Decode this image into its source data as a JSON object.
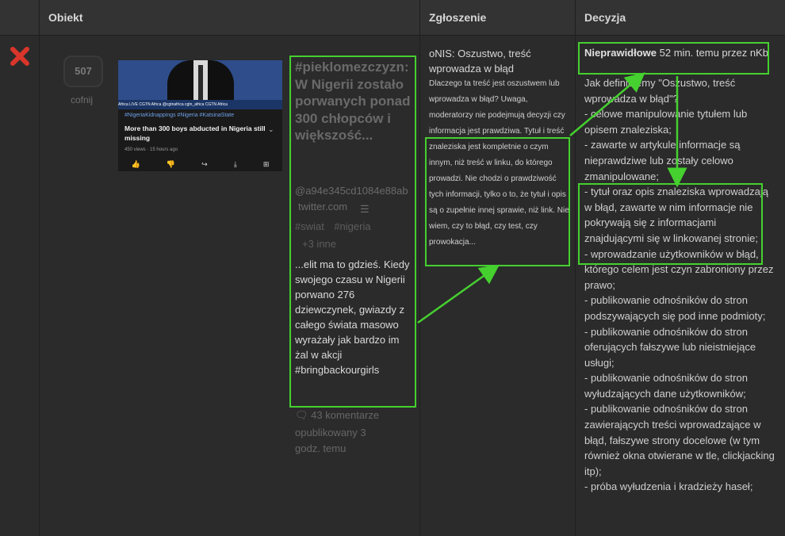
{
  "header": {
    "col_object": "Obiekt",
    "col_report": "Zgłoszenie",
    "col_decision": "Decyzja"
  },
  "vote": {
    "count": "507",
    "undo": "cofnij"
  },
  "thumbnail": {
    "lower_third": "Africa LIVE    CGTN Africa    @cgtnafrica    cgtn_africa    CGTN Africa",
    "tags": "#NigeriaKidnappings #Nigeria #KatsinaState",
    "title": "More than 300 boys abducted in Nigeria still missing",
    "meta": "450 views · 15 hours ago"
  },
  "entry": {
    "title": "#pieklomezczyzn: W Nigerii zostało porwanych ponad 300 chłopców i większość...",
    "hash": "@a94e345cd1084e88ab",
    "domain": "twitter.com",
    "tags": [
      "#swiat",
      "#nigeria"
    ],
    "more_tags": "+3 inne",
    "description": "...elit ma to gdzieś. Kiedy swojego czasu w Nigerii porwano 276 dziewczynek, gwiazdy z całego świata masowo wyrażały jak bardzo im żal w akcji #bringbackourgirls",
    "comments": "43 komentarze",
    "published": "opublikowany 3 godz. temu"
  },
  "report": {
    "reason": "oNIS: Oszustwo, treść wprowadza w błąd",
    "body": "Dlaczego ta treść jest oszustwem lub wprowadza w błąd? Uwaga, moderatorzy nie podejmują decyzji czy informacja jest prawdziwa. Tytuł i treść znaleziska jest kompletnie o czym innym, niż treść w linku, do którego prowadzi. Nie chodzi o prawdziwość tych informacji, tylko o to, że tytuł i opis są o zupełnie innej sprawie, niż link. Nie wiem, czy to błąd, czy test, czy prowokacja..."
  },
  "decision": {
    "verdict": "Nieprawidłowe",
    "time_by": "52 min. temu przez nKb",
    "body": "Jak definiujemy \"Oszustwo, treść wprowadza w błąd\"?\n- celowe manipulowanie tytułem lub opisem znaleziska;\n- zawarte w artykule informacje są nieprawdziwe lub zostały celowo zmanipulowane;\n- tytuł oraz opis znaleziska wprowadzają w błąd, zawarte w nim informacje nie pokrywają się z informacjami znajdującymi się w linkowanej stronie;\n- wprowadzanie użytkowników w błąd, którego celem jest czyn zabroniony przez prawo;\n- publikowanie odnośników do stron podszywających się pod inne podmioty;\n- publikowanie odnośników do stron oferujących fałszywe lub nieistniejące usługi;\n- publikowanie odnośników do stron wyłudzających dane użytkowników;\n- publikowanie odnośników do stron zawierających treści wprowadzające w błąd, fałszywe strony docelowe (w tym również okna otwierane w tle, clickjacking itp);\n- próba wyłudzenia i kradzieży haseł;"
  },
  "colors": {
    "highlight": "#45d02f",
    "reject": "#d9362b"
  }
}
